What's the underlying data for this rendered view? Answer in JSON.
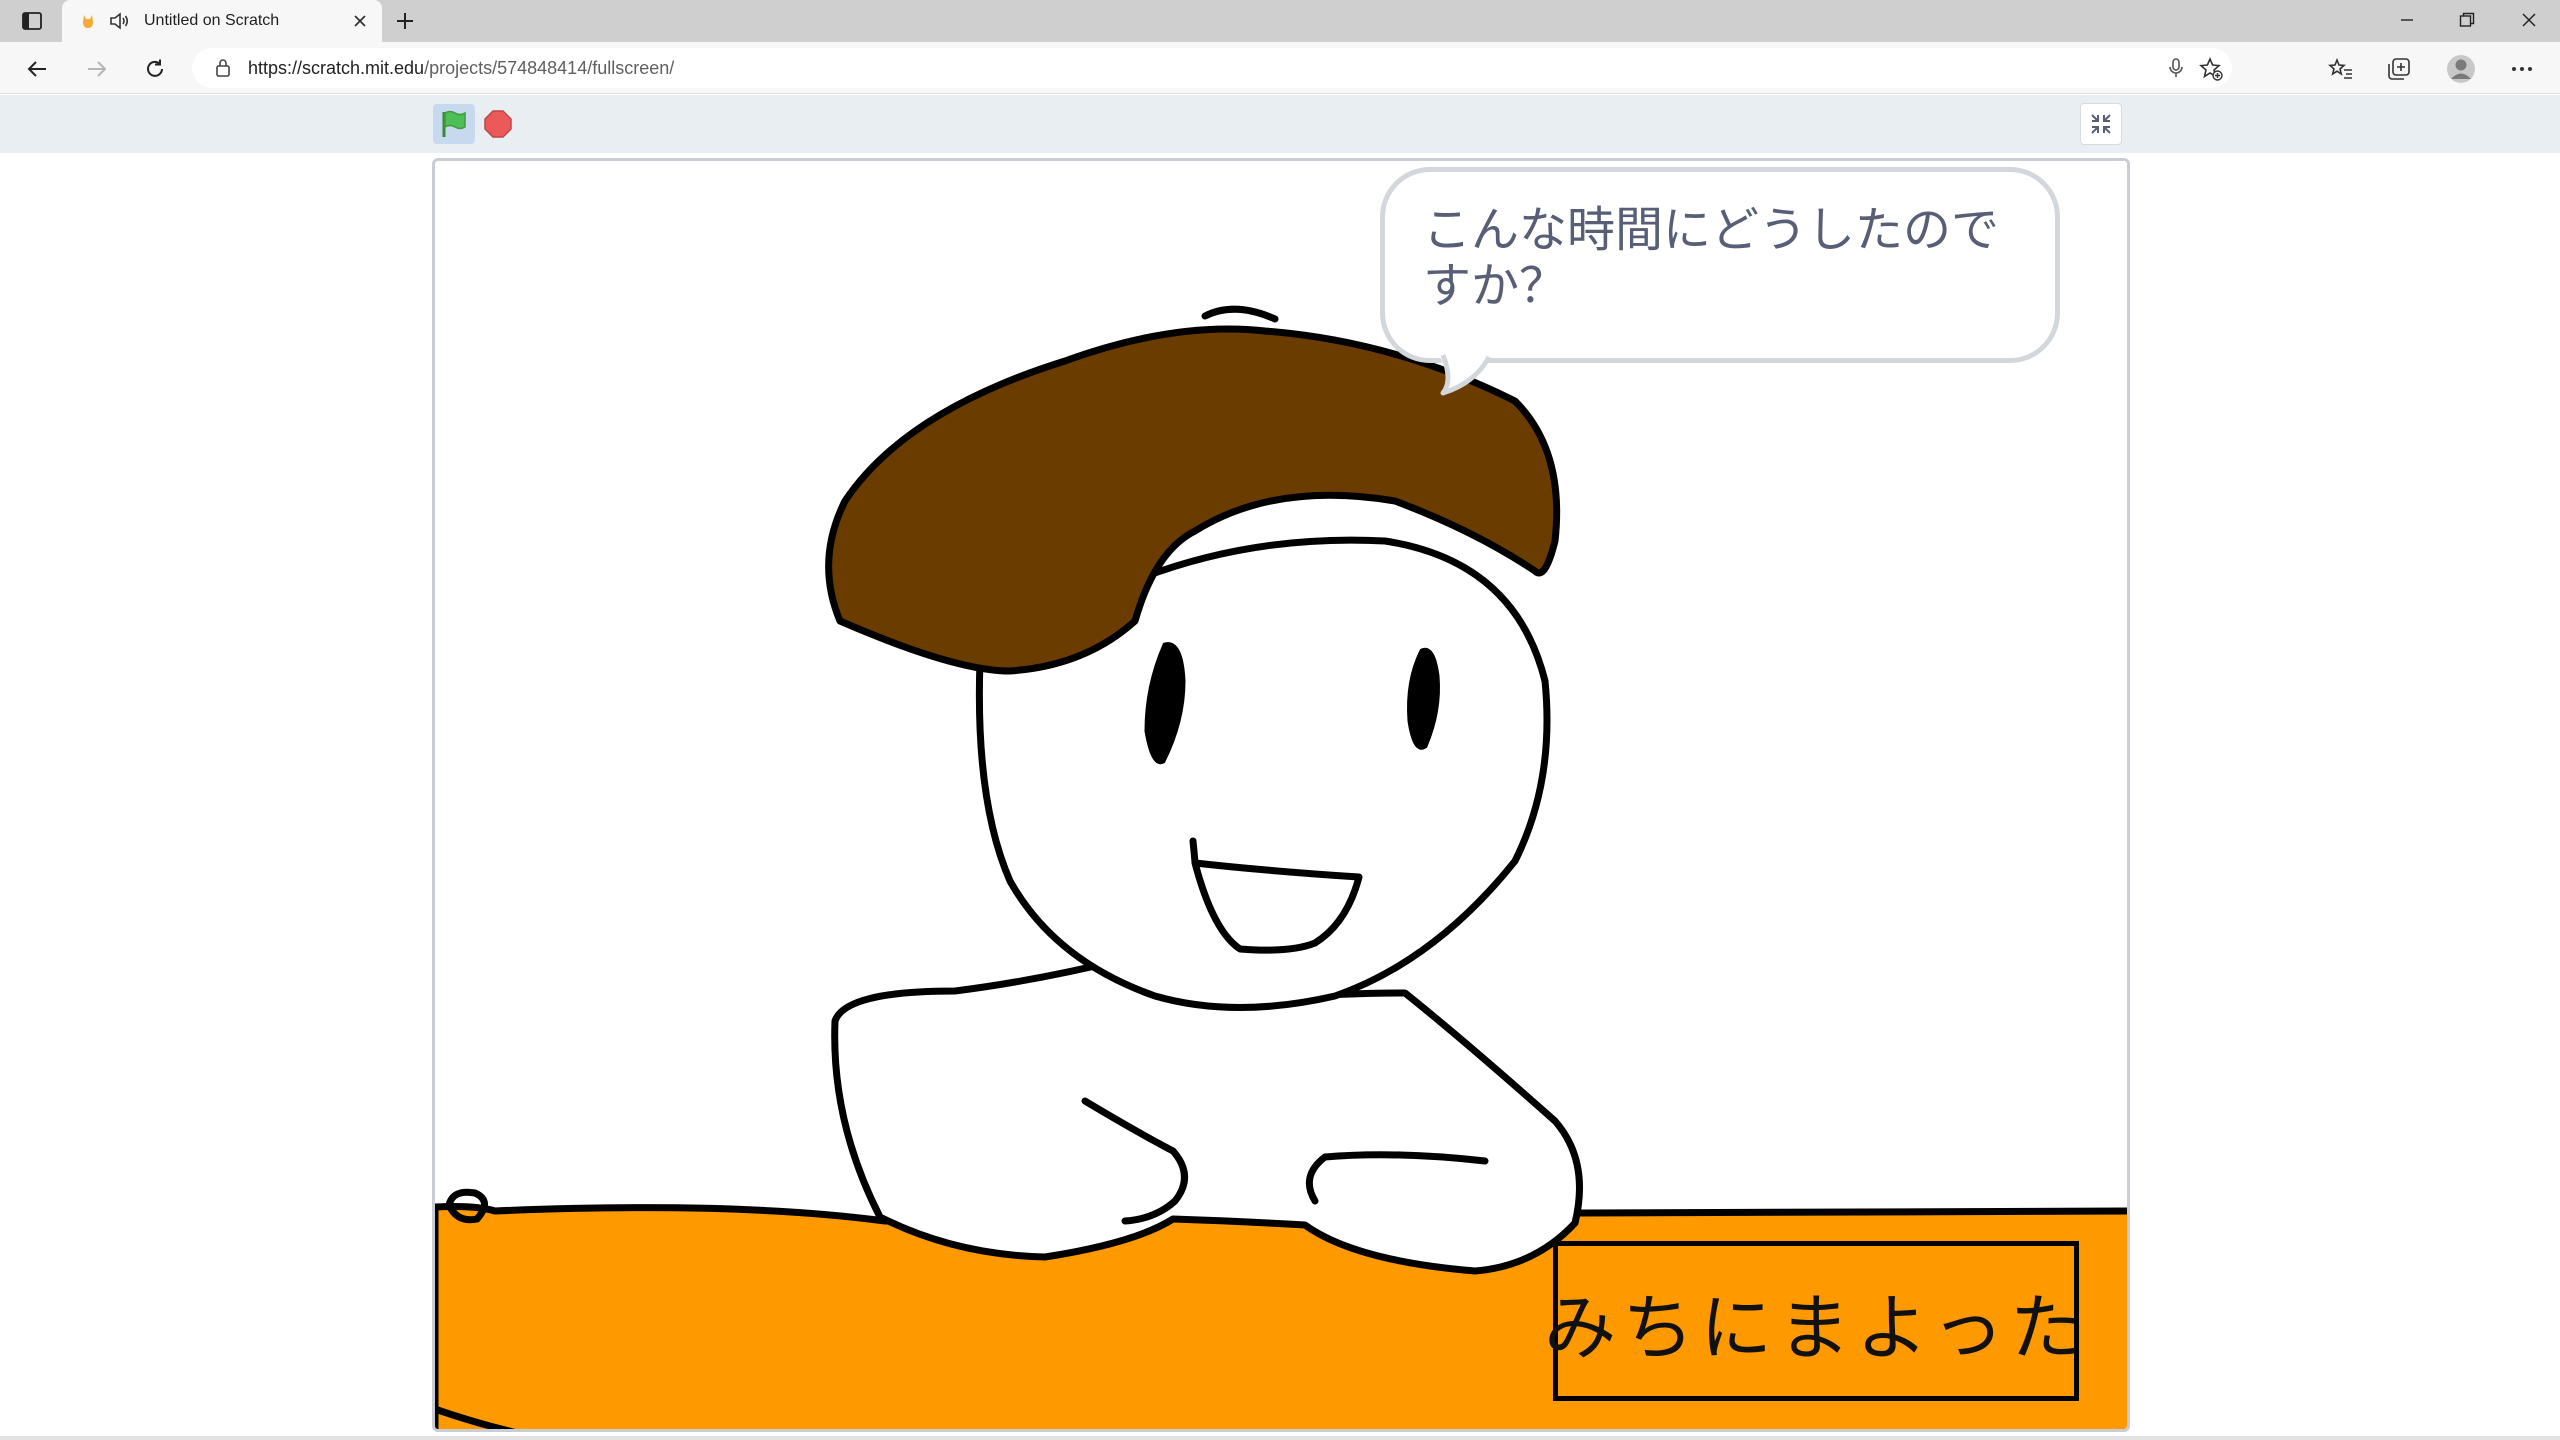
{
  "browser": {
    "tab": {
      "title": "Untitled on Scratch",
      "favicon": "scratch-cat-icon",
      "audio_icon": "speaker-icon"
    },
    "address": {
      "url_host": "https://scratch.mit.edu",
      "url_path": "/projects/574848414/fullscreen/"
    },
    "toolbar_icons": [
      "back-icon",
      "forward-icon",
      "refresh-icon",
      "lock-icon",
      "microphone-icon",
      "add-favorite-icon",
      "favorites-icon",
      "collections-icon",
      "profile-icon",
      "more-icon"
    ],
    "window_controls": [
      "minimize-icon",
      "restore-icon",
      "close-icon"
    ]
  },
  "scratch": {
    "controls": {
      "green_flag": "green-flag-icon",
      "stop": "stop-sign-icon",
      "exit_fullscreen": "exit-fullscreen-icon"
    },
    "stage": {
      "speech_bubble": "こんな時間にどうしたのですか？",
      "text_box": "みちにまよった"
    }
  },
  "colors": {
    "tab_strip": "#cfcfcf",
    "toolbar": "#f7f7f7",
    "scratch_bar": "#e9eef2",
    "hair": "#6b3c00",
    "desk": "#ff9900",
    "outline": "#000000",
    "bubble_text": "#575e75"
  }
}
